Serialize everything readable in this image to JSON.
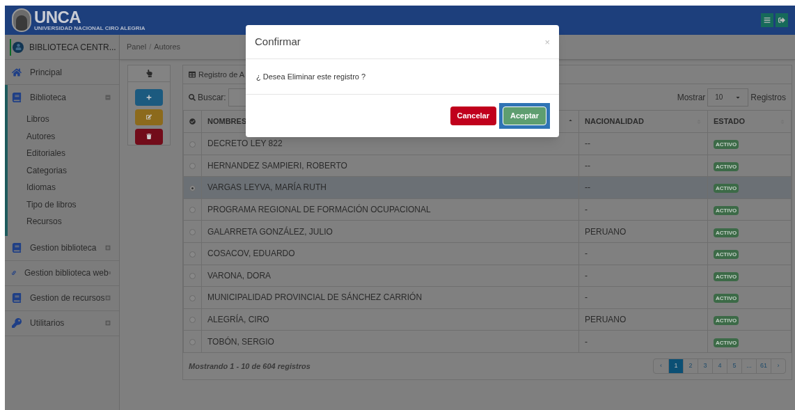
{
  "header": {
    "logo": "UNCA",
    "logo_subtitle": "UNIVERSIDAD NACIONAL CIRO ALEGRIA"
  },
  "sidebar": {
    "user": "BIBLIOTECA CENTR...",
    "items": [
      {
        "label": "Principal",
        "kind": "home",
        "expanded": false,
        "expandable": false
      },
      {
        "label": "Biblioteca",
        "kind": "book",
        "expanded": true,
        "expandable": true,
        "children": [
          {
            "label": "Libros"
          },
          {
            "label": "Autores"
          },
          {
            "label": "Editoriales"
          },
          {
            "label": "Categorias"
          },
          {
            "label": "Idiomas"
          },
          {
            "label": "Tipo de libros"
          },
          {
            "label": "Recursos"
          }
        ]
      },
      {
        "label": "Gestion biblioteca",
        "kind": "book",
        "expanded": false,
        "expandable": true
      },
      {
        "label": "Gestion biblioteca web",
        "kind": "link",
        "expanded": false,
        "expandable": true
      },
      {
        "label": "Gestion de recursos",
        "kind": "book",
        "expanded": false,
        "expandable": true
      },
      {
        "label": "Utilitarios",
        "kind": "key",
        "expanded": false,
        "expandable": true
      }
    ]
  },
  "breadcrumb": {
    "separator": "/",
    "items": [
      "Panel",
      "Autores"
    ]
  },
  "table_panel": {
    "title": "Registro de A",
    "search_label": "Buscar:",
    "show_label": "Mostrar",
    "page_size": "10",
    "records_label": "Registros",
    "columns": [
      "NOMBRES",
      "NACIONALIDAD",
      "ESTADO"
    ],
    "rows": [
      {
        "name": "DECRETO LEY 822",
        "nationality": "--",
        "status": "ACTIVO",
        "selected": false
      },
      {
        "name": "HERNANDEZ SAMPIERI, ROBERTO",
        "nationality": "--",
        "status": "ACTIVO",
        "selected": false
      },
      {
        "name": "VARGAS LEYVA, MARÍA RUTH",
        "nationality": "--",
        "status": "ACTIVO",
        "selected": true
      },
      {
        "name": "PROGRAMA REGIONAL DE FORMACIÓN OCUPACIONAL",
        "nationality": "-",
        "status": "ACTIVO",
        "selected": false
      },
      {
        "name": "GALARRETA GONZÁLEZ, JULIO",
        "nationality": "PERUANO",
        "status": "ACTIVO",
        "selected": false
      },
      {
        "name": "COSACOV, EDUARDO",
        "nationality": "-",
        "status": "ACTIVO",
        "selected": false
      },
      {
        "name": "VARONA, DORA",
        "nationality": "-",
        "status": "ACTIVO",
        "selected": false
      },
      {
        "name": "MUNICIPALIDAD PROVINCIAL DE SÁNCHEZ CARRIÓN",
        "nationality": "-",
        "status": "ACTIVO",
        "selected": false
      },
      {
        "name": "ALEGRÍA, CIRO",
        "nationality": "PERUANO",
        "status": "ACTIVO",
        "selected": false
      },
      {
        "name": "TOBÓN, SERGIO",
        "nationality": "-",
        "status": "ACTIVO",
        "selected": false
      }
    ],
    "footer": "Mostrando 1 - 10 de 604 registros",
    "pagination": [
      {
        "label": "‹",
        "selected": false
      },
      {
        "label": "1",
        "selected": true
      },
      {
        "label": "2",
        "selected": false
      },
      {
        "label": "3",
        "selected": false
      },
      {
        "label": "4",
        "selected": false
      },
      {
        "label": "5",
        "selected": false
      },
      {
        "label": "...",
        "selected": false
      },
      {
        "label": "61",
        "selected": false
      },
      {
        "label": "›",
        "selected": false
      }
    ]
  },
  "dialog": {
    "title": "Confirmar",
    "close": "×",
    "message": "¿ Desea Eliminar este registro ?",
    "buttons": [
      {
        "label": "Cancelar",
        "kind": "cancel",
        "focused": false
      },
      {
        "label": "Aceptar",
        "kind": "accept",
        "focused": true
      }
    ]
  }
}
